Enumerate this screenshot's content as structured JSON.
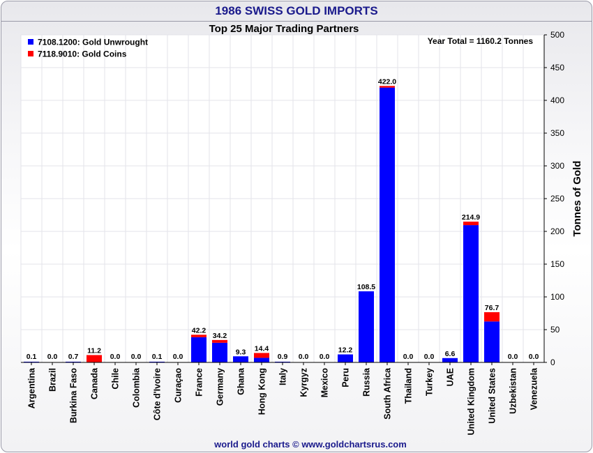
{
  "header": {
    "title": "1986 SWISS GOLD IMPORTS",
    "subtitle": "Top 25 Major Trading Partners",
    "footer": "world gold charts © www.goldchartsrus.com"
  },
  "colors": {
    "unwrought": "#0000ff",
    "coins": "#ff0000",
    "title": "#1a1a8c"
  },
  "chart_data": {
    "type": "bar",
    "stacked": true,
    "title": "1986 SWISS GOLD IMPORTS",
    "subtitle": "Top 25 Major Trading Partners",
    "ylabel": "Tonnes of Gold",
    "xlabel": "",
    "ylim": [
      0,
      500
    ],
    "yticks": [
      0,
      50,
      100,
      150,
      200,
      250,
      300,
      350,
      400,
      450,
      500
    ],
    "y_axis_side": "right",
    "grid": true,
    "legend_position": "top-left",
    "annotation": "Year Total = 1160.2 Tonnes",
    "categories": [
      "Argentina",
      "Brazil",
      "Burkina Faso",
      "Canada",
      "Chile",
      "Colombia",
      "Côte d'Ivoire",
      "Curaçao",
      "France",
      "Germany",
      "Ghana",
      "Hong Kong",
      "Italy",
      "Kyrgyz",
      "Mexico",
      "Peru",
      "Russia",
      "South Africa",
      "Thailand",
      "Turkey",
      "UAE",
      "United Kingdom",
      "United States",
      "Uzbekistan",
      "Venezuela"
    ],
    "series": [
      {
        "name": "7108.1200: Gold Unwrought",
        "color": "#0000ff",
        "values": [
          0.1,
          0,
          0.7,
          0,
          0,
          0,
          0.1,
          0,
          38.5,
          30,
          9.3,
          7,
          0.9,
          0,
          0,
          12.2,
          108.5,
          419.5,
          0,
          0,
          6.6,
          209.5,
          62.5,
          0,
          0
        ]
      },
      {
        "name": "7118.9010: Gold Coins",
        "color": "#ff0000",
        "values": [
          0,
          0,
          0,
          11.2,
          0,
          0,
          0,
          0,
          3.7,
          4.2,
          0,
          7.4,
          0,
          0,
          0,
          0,
          0,
          2.5,
          0,
          0,
          0,
          5.4,
          14.2,
          0,
          0
        ]
      }
    ],
    "totals": [
      "0.1",
      "0.0",
      "0.7",
      "11.2",
      "0.0",
      "0.0",
      "0.1",
      "0.0",
      "42.2",
      "34.2",
      "9.3",
      "14.4",
      "0.9",
      "0.0",
      "0.0",
      "12.2",
      "108.5",
      "422.0",
      "0.0",
      "0.0",
      "6.6",
      "214.9",
      "76.7",
      "0.0",
      "0.0"
    ]
  }
}
